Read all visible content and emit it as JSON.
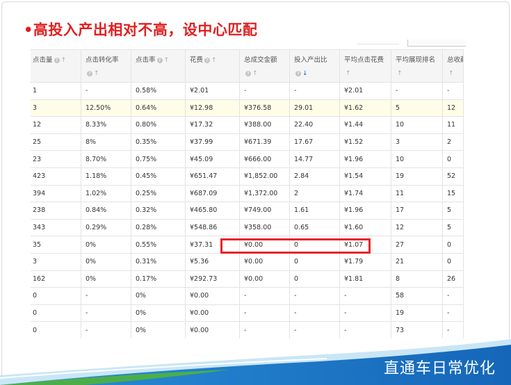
{
  "slide": {
    "title": "•高投入产出相对不高，设中心匹配",
    "footer": "直通车日常优化"
  },
  "table": {
    "columns": [
      {
        "label": "点击量",
        "help": true,
        "sort": "up",
        "second_line": false
      },
      {
        "label": "点击转化率",
        "help": true,
        "sort": "up",
        "second_line": true
      },
      {
        "label": "点击率",
        "help": true,
        "sort": "up",
        "second_line": false
      },
      {
        "label": "花费",
        "help": true,
        "sort": "up",
        "second_line": false
      },
      {
        "label": "总成交金额",
        "help": true,
        "sort": "up",
        "second_line": true
      },
      {
        "label": "投入产出比",
        "help": true,
        "sort": "down-active",
        "second_line": true
      },
      {
        "label": "平均点击花费",
        "help": false,
        "sort": "up",
        "second_line": true
      },
      {
        "label": "平均展现排名",
        "help": false,
        "sort": "up",
        "second_line": true
      },
      {
        "label": "总收藏",
        "help": false,
        "sort": "up",
        "second_line": true
      }
    ],
    "rows": [
      [
        "1",
        "-",
        "0.58%",
        "¥2.01",
        "-",
        "-",
        "¥2.01",
        "-",
        "-"
      ],
      [
        "3",
        "12.50%",
        "0.64%",
        "¥12.98",
        "¥376.58",
        "29.01",
        "¥1.62",
        "5",
        "12"
      ],
      [
        "12",
        "8.33%",
        "0.80%",
        "¥17.32",
        "¥388.00",
        "22.40",
        "¥1.44",
        "10",
        "11"
      ],
      [
        "25",
        "8%",
        "0.35%",
        "¥37.99",
        "¥671.39",
        "17.67",
        "¥1.52",
        "3",
        "2"
      ],
      [
        "23",
        "8.70%",
        "0.75%",
        "¥45.09",
        "¥666.00",
        "14.77",
        "¥1.96",
        "10",
        "0"
      ],
      [
        "423",
        "1.18%",
        "0.45%",
        "¥651.47",
        "¥1,852.00",
        "2.84",
        "¥1.54",
        "19",
        "52"
      ],
      [
        "394",
        "1.02%",
        "0.25%",
        "¥687.09",
        "¥1,372.00",
        "2",
        "¥1.74",
        "11",
        "15"
      ],
      [
        "238",
        "0.84%",
        "0.32%",
        "¥465.80",
        "¥749.00",
        "1.61",
        "¥1.96",
        "17",
        "5"
      ],
      [
        "343",
        "0.29%",
        "0.28%",
        "¥548.86",
        "¥358.00",
        "0.65",
        "¥1.60",
        "12",
        "5"
      ],
      [
        "35",
        "0%",
        "0.55%",
        "¥37.31",
        "¥0.00",
        "0",
        "¥1.07",
        "27",
        "0"
      ],
      [
        "3",
        "0%",
        "0.31%",
        "¥5.36",
        "¥0.00",
        "0",
        "¥1.79",
        "21",
        "0"
      ],
      [
        "162",
        "0%",
        "0.17%",
        "¥292.73",
        "¥0.00",
        "0",
        "¥1.81",
        "8",
        "26"
      ],
      [
        "0",
        "-",
        "0%",
        "¥0.00",
        "-",
        "-",
        "-",
        "58",
        "-"
      ],
      [
        "0",
        "-",
        "0%",
        "¥0.00",
        "-",
        "-",
        "-",
        "19",
        "-"
      ],
      [
        "0",
        "-",
        "0%",
        "¥0.00",
        "-",
        "-",
        "-",
        "73",
        "-"
      ]
    ],
    "highlighted_row_index": 1,
    "boxed_row_index": 7
  },
  "colors": {
    "title_red": "#e02020",
    "highlight_box": "#e8242c",
    "footer_blue": "#1a73c8",
    "footer_green": "#4cae48"
  },
  "icons": {
    "help": "question-circle-icon",
    "sort_up": "arrow-up-icon",
    "sort_down": "arrow-down-icon"
  }
}
